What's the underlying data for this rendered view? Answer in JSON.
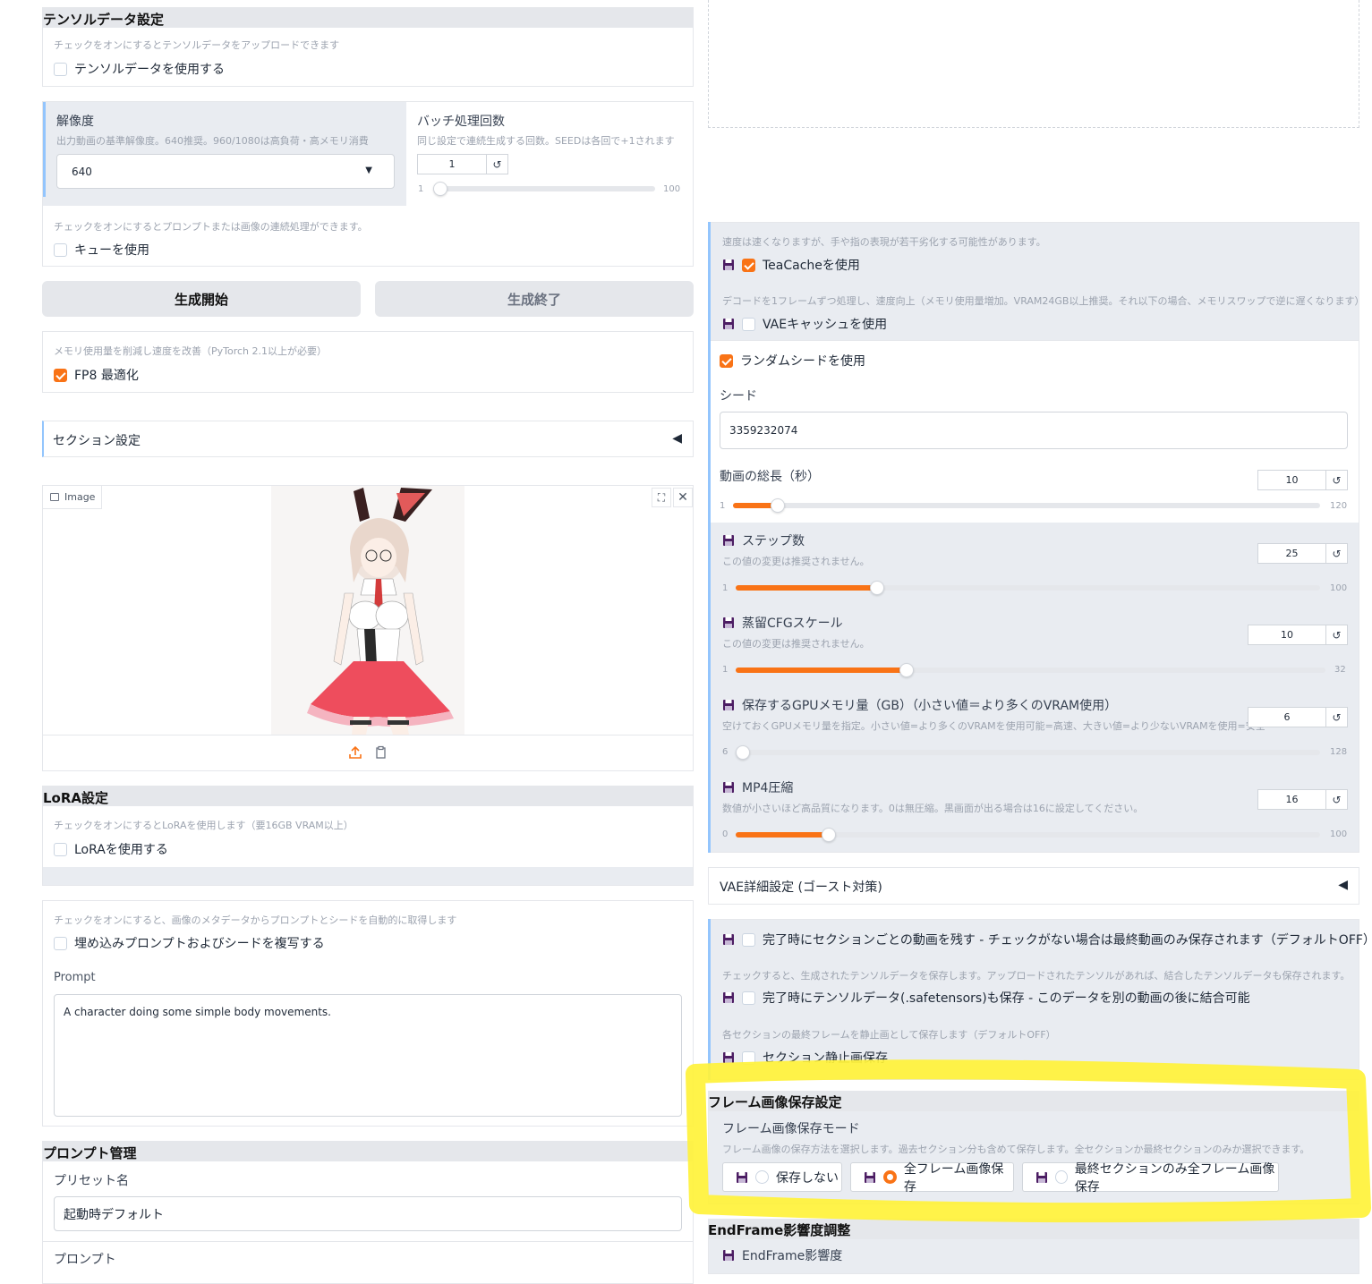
{
  "tensor": {
    "header": "テンソルデータ設定",
    "hint": "チェックをオンにするとテンソルデータをアップロードできます",
    "checkbox_label": "テンソルデータを使用する"
  },
  "resolution": {
    "label": "解像度",
    "hint": "出力動画の基準解像度。640推奨。960/1080は高負荷・高メモリ消費",
    "value": "640"
  },
  "batch": {
    "label": "バッチ処理回数",
    "hint": "同じ設定で連続生成する回数。SEEDは各回で+1されます",
    "value": "1",
    "min": "1",
    "max": "100",
    "fraction": 0.0
  },
  "queue": {
    "hint": "チェックをオンにするとプロンプトまたは画像の連続処理ができます。",
    "checkbox_label": "キューを使用"
  },
  "buttons": {
    "start": "生成開始",
    "end": "生成終了"
  },
  "fp8": {
    "hint": "メモリ使用量を削減し速度を改善（PyTorch 2.1以上が必要）",
    "checkbox_label": "FP8 最適化"
  },
  "section_settings": {
    "label": "セクション設定",
    "arrow": "◀"
  },
  "image": {
    "tab_label": "Image"
  },
  "lora": {
    "header": "LoRA設定",
    "hint": "チェックをオンにするとLoRAを使用します（要16GB VRAM以上）",
    "checkbox_label": "LoRAを使用する"
  },
  "metadata": {
    "hint": "チェックをオンにすると、画像のメタデータからプロンプトとシードを自動的に取得します",
    "checkbox_label": "埋め込みプロンプトおよびシードを複写する"
  },
  "prompt": {
    "label": "Prompt",
    "value": "A character doing some simple body movements."
  },
  "prompt_mgmt": {
    "header": "プロンプト管理",
    "preset_label": "プリセット名",
    "preset_value": "起動時デフォルト",
    "prompt_label": "プロンプト"
  },
  "teacache": {
    "hint": "速度は速くなりますが、手や指の表現が若干劣化する可能性があります。",
    "checkbox_label": "TeaCacheを使用"
  },
  "vae_cache": {
    "hint": "デコードを1フレームずつ処理し、速度向上（メモリ使用量増加。VRAM24GB以上推奨。それ以下の場合、メモリスワップで逆に遅くなります）",
    "checkbox_label": "VAEキャッシュを使用"
  },
  "random_seed": {
    "checkbox_label": "ランダムシードを使用"
  },
  "seed": {
    "label": "シード",
    "value": "3359232074"
  },
  "video_length": {
    "label": "動画の総長（秒）",
    "value": "10",
    "min": "1",
    "max": "120",
    "fraction": 0.076
  },
  "steps": {
    "label": "ステップ数",
    "hint": "この値の変更は推奨されません。",
    "value": "25",
    "min": "1",
    "max": "100",
    "fraction": 0.242
  },
  "cfg": {
    "label": "蒸留CFGスケール",
    "hint": "この値の変更は推奨されません。",
    "value": "10",
    "min": "1",
    "max": "32",
    "fraction": 0.29
  },
  "gpu_mem": {
    "label": "保存するGPUメモリ量（GB）（小さい値＝より多くのVRAM使用）",
    "hint": "空けておくGPUメモリ量を指定。小さい値=より多くのVRAMを使用可能=高速、大きい値=より少ないVRAMを使用=安全",
    "value": "6",
    "min": "6",
    "max": "128",
    "fraction": 0.0
  },
  "mp4": {
    "label": "MP4圧縮",
    "hint": "数値が小さいほど高品質になります。0は無圧縮。黒画面が出る場合は16に設定してください。",
    "value": "16",
    "min": "0",
    "max": "100",
    "fraction": 0.16
  },
  "vae_detail": {
    "label": "VAE詳細設定 (ゴースト対策)",
    "arrow": "◀"
  },
  "keep_section_video": {
    "checkbox_label": "完了時にセクションごとの動画を残す - チェックがない場合は最終動画のみ保存されます（デフォルトOFF）"
  },
  "save_tensor": {
    "hint": "チェックすると、生成されたテンソルデータを保存します。アップロードされたテンソルがあれば、結合したテンソルデータも保存されます。",
    "checkbox_label": "完了時にテンソルデータ(.safetensors)も保存 - このデータを別の動画の後に結合可能"
  },
  "section_still": {
    "hint": "各セクションの最終フレームを静止画として保存します（デフォルトOFF）",
    "checkbox_label": "セクション静止画保存"
  },
  "frame_save": {
    "header": "フレーム画像保存設定",
    "mode_label": "フレーム画像保存モード",
    "hint": "フレーム画像の保存方法を選択します。過去セクション分も含めて保存します。全セクションか最終セクションのみか選択できます。",
    "options": [
      "保存しない",
      "全フレーム画像保存",
      "最終セクションのみ全フレーム画像保存"
    ],
    "selected": "全フレーム画像保存"
  },
  "endframe": {
    "header": "EndFrame影響度調整",
    "label": "EndFrame影響度"
  },
  "colors": {
    "accent": "#f97316",
    "highlight": "#fff23a",
    "panel_bg": "#e9ecf1"
  }
}
